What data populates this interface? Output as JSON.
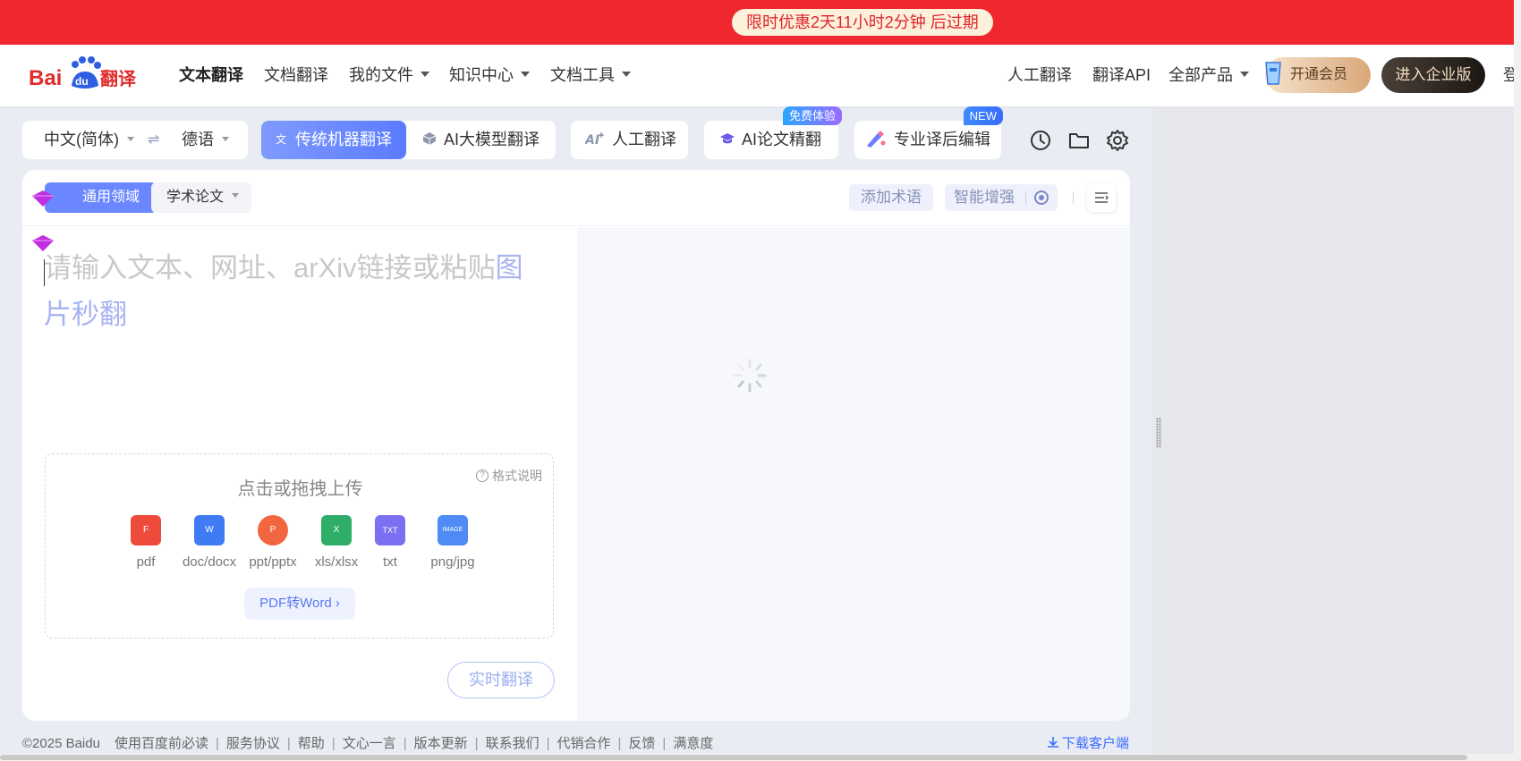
{
  "promo": {
    "text": "限时优惠2天11小时2分钟 后过期"
  },
  "header": {
    "logo_text": "Baidu翻译",
    "nav": [
      "文本翻译",
      "文档翻译",
      "我的文件",
      "知识中心",
      "文档工具"
    ],
    "right_links": [
      "人工翻译",
      "翻译API",
      "全部产品"
    ],
    "vip_label": "开通会员",
    "enterprise_label": "进入企业版",
    "login_partial": "登"
  },
  "toolbar": {
    "source_lang": "中文(简体)",
    "swap_icon": "⇌",
    "target_lang": "德语",
    "mode_machine": "传统机器翻译",
    "mode_ai": "AI大模型翻译",
    "human": "人工翻译",
    "paper": "AI论文精翻",
    "paper_badge": "免费体验",
    "edit": "专业译后编辑",
    "edit_badge": "NEW",
    "icons": [
      "history-icon",
      "folder-icon",
      "settings-icon"
    ]
  },
  "card": {
    "domain_general": "通用领域",
    "domain_academic": "学术论文",
    "add_term": "添加术语",
    "smart_enhance": "智能增强",
    "placeholder_main": "请输入文本、网址、arXiv链接或粘贴",
    "placeholder_highlight": "图片秒翻",
    "upload": {
      "title": "点击或拖拽上传",
      "help": "格式说明",
      "types": [
        {
          "label": "pdf",
          "icon": "pdf-icon",
          "color": "#ef4b3c",
          "mark": "F"
        },
        {
          "label": "doc/docx",
          "icon": "word-icon",
          "color": "#3f7bf5",
          "mark": "W"
        },
        {
          "label": "ppt/pptx",
          "icon": "ppt-icon",
          "color": "#f2663f",
          "mark": "P"
        },
        {
          "label": "xls/xlsx",
          "icon": "excel-icon",
          "color": "#2fae6a",
          "mark": "X"
        },
        {
          "label": "txt",
          "icon": "txt-icon",
          "color": "#7b6ff2",
          "mark": "TXT"
        },
        {
          "label": "png/jpg",
          "icon": "image-icon",
          "color": "#4e8bf5",
          "mark": "IMAGE"
        }
      ],
      "pdf_to_word": "PDF转Word ›"
    },
    "realtime": "实时翻译"
  },
  "footer": {
    "copyright": "©2025 Baidu",
    "links": [
      "使用百度前必读",
      "服务协议",
      "帮助",
      "文心一言",
      "版本更新",
      "联系我们",
      "代销合作",
      "反馈",
      "满意度"
    ],
    "download": "下载客户端"
  }
}
